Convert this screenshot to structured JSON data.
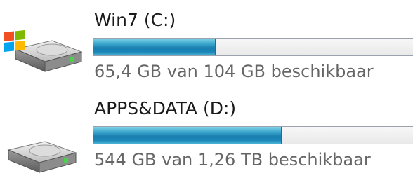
{
  "colors": {
    "bar_fill": "#1a7fb0",
    "bar_bg": "#f0f0f0",
    "bar_border": "#9aa3ad"
  },
  "drives": [
    {
      "name": "Win7 (C:)",
      "free_text": "65,4 GB van 104 GB beschikbaar",
      "used_fraction": 0.37,
      "icon": "system-drive-windows-icon"
    },
    {
      "name": "APPS&DATA (D:)",
      "free_text": "544 GB van 1,26 TB beschikbaar",
      "used_fraction": 0.57,
      "icon": "hard-drive-icon"
    }
  ]
}
